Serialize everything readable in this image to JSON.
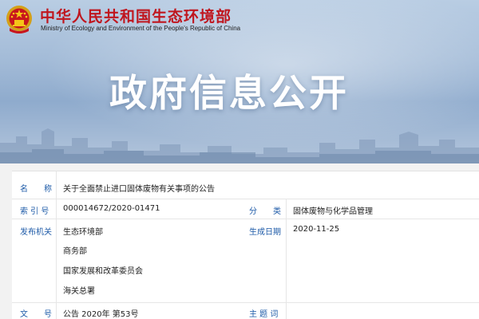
{
  "header": {
    "ministry_cn": "中华人民共和国生态环境部",
    "ministry_en": "Ministry of Ecology and Environment of the People's Republic of China",
    "banner_title": "政府信息公开"
  },
  "info": {
    "name_label": "名　　称",
    "name_value": "关于全面禁止进口固体废物有关事项的公告",
    "index_label": "索 引 号",
    "index_value": "000014672/2020-01471",
    "category_label": "分　　类",
    "category_value": "固体废物与化学品管理",
    "publisher_label": "发布机关",
    "publishers": [
      "生态环境部",
      "商务部",
      "国家发展和改革委员会",
      "海关总署"
    ],
    "date_label": "生成日期",
    "date_value": "2020-11-25",
    "docno_label": "文　　号",
    "docno_value": "公告 2020年 第53号",
    "keywords_label": "主 题 词",
    "keywords_value": ""
  },
  "colors": {
    "ministry_red": "#c0161e",
    "label_blue": "#1e5ba8"
  }
}
